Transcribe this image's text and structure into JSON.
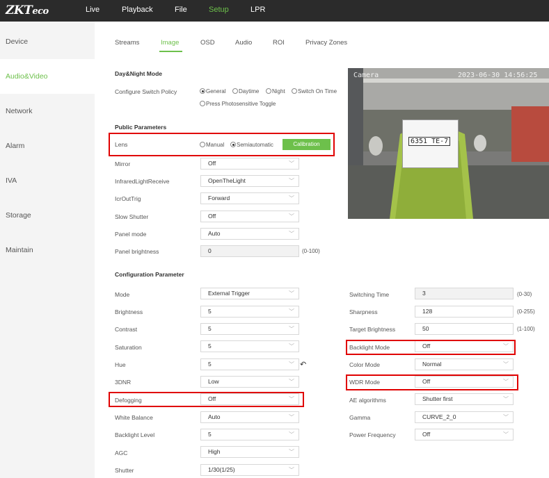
{
  "app": {
    "logo_zk": "ZKT",
    "logo_eco": "eco"
  },
  "nav": [
    "Live",
    "Playback",
    "File",
    "Setup",
    "LPR"
  ],
  "sidebar": [
    "Device",
    "Audio&Video",
    "Network",
    "Alarm",
    "IVA",
    "Storage",
    "Maintain"
  ],
  "tabs": [
    "Streams",
    "Image",
    "OSD",
    "Audio",
    "ROI",
    "Privacy Zones"
  ],
  "day_night": {
    "title": "Day&Night Mode",
    "label": "Configure Switch Policy",
    "options": [
      "General",
      "Daytime",
      "Night",
      "Switch On Time",
      "Press Photosensitive Toggle"
    ]
  },
  "public": {
    "title": "Public Parameters",
    "lens_label": "Lens",
    "lens_options": [
      "Manual",
      "Semiautomatic"
    ],
    "calibration": "Calibration",
    "rows": [
      {
        "label": "Mirror",
        "value": "Off"
      },
      {
        "label": "InfraredLightReceive",
        "value": "OpenTheLight"
      },
      {
        "label": "IcrOutTrig",
        "value": "Forward"
      },
      {
        "label": "Slow Shutter",
        "value": "Off"
      },
      {
        "label": "Panel mode",
        "value": "Auto"
      },
      {
        "label": "Panel brightness",
        "value": "0",
        "range": "(0-100)"
      }
    ]
  },
  "config": {
    "title": "Configuration Parameter",
    "left": [
      {
        "label": "Mode",
        "value": "External Trigger"
      },
      {
        "label": "Brightness",
        "value": "5"
      },
      {
        "label": "Contrast",
        "value": "5"
      },
      {
        "label": "Saturation",
        "value": "5"
      },
      {
        "label": "Hue",
        "value": "5"
      },
      {
        "label": "3DNR",
        "value": "Low"
      },
      {
        "label": "Defogging",
        "value": "Off"
      },
      {
        "label": "White Balance",
        "value": "Auto"
      },
      {
        "label": "Backlight Level",
        "value": "5"
      },
      {
        "label": "AGC",
        "value": "High"
      },
      {
        "label": "Shutter",
        "value": "1/30(1/25)"
      }
    ],
    "right": [
      {
        "label": "Switching Time",
        "value": "3",
        "range": "(0-30)"
      },
      {
        "label": "Sharpness",
        "value": "128",
        "range": "(0-255)"
      },
      {
        "label": "Target Brightness",
        "value": "50",
        "range": "(1-100)"
      },
      {
        "label": "Backlight Mode",
        "value": "Off"
      },
      {
        "label": "Color Mode",
        "value": "Normal"
      },
      {
        "label": "WDR Mode",
        "value": "Off"
      },
      {
        "label": "AE algorithms",
        "value": "Shutter first"
      },
      {
        "label": "Gamma",
        "value": "CURVE_2_0"
      },
      {
        "label": "Power Frequency",
        "value": "Off"
      }
    ]
  },
  "preview": {
    "osd_left": "Camera",
    "osd_right": "2023-06-30 14:56:25",
    "plate": "6351 TE-7"
  },
  "colors": {
    "accent": "#6dc04b",
    "highlight": "#e00000",
    "topbar": "#2b2b2b"
  }
}
